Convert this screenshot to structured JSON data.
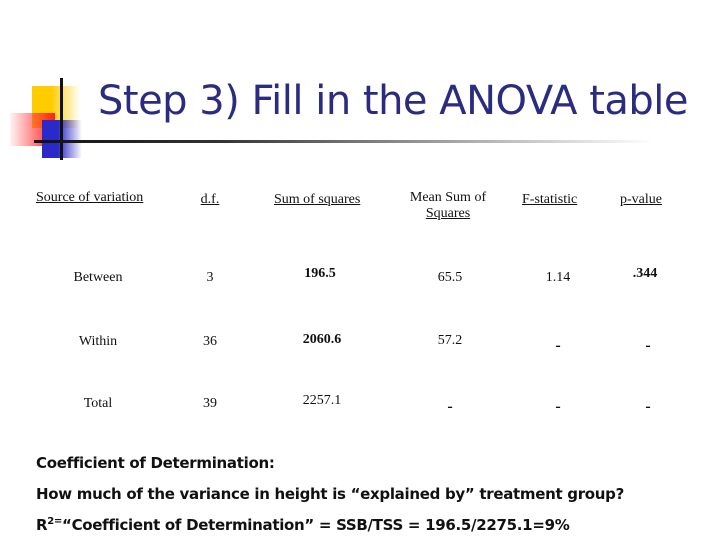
{
  "slide": {
    "title": "Step 3) Fill in the ANOVA table"
  },
  "table": {
    "headers": {
      "source": "Source of variation",
      "df": "d.f.",
      "ss": "Sum of squares",
      "ms_line1": "Mean Sum of",
      "ms_line2": "Squares",
      "f": "F-statistic",
      "p": "p-value"
    },
    "rows": [
      {
        "source": "Between",
        "df": "3",
        "ss": "196.5",
        "ms": "65.5",
        "f": "1.14",
        "p": ".344"
      },
      {
        "source": "Within",
        "df": "36",
        "ss": "2060.6",
        "ms": "57.2",
        "f": "-",
        "p": "-"
      },
      {
        "source": "Total",
        "df": "39",
        "ss": "2257.1",
        "ms": "-",
        "f": "-",
        "p": "-"
      }
    ]
  },
  "footer": {
    "line1": "Coefficient of Determination:",
    "line2": "How much of the variance in height is “explained by” treatment group?",
    "line3_prefix": "R",
    "line3_sup": "2=",
    "line3_rest": "“Coefficient of Determination” = SSB/TSS = 196.5/2275.1=9%"
  },
  "colors": {
    "title": "#2b2b80",
    "logo_yellow": "#ffcc00",
    "logo_red": "#ff2020",
    "logo_blue": "#2a2ac8"
  }
}
